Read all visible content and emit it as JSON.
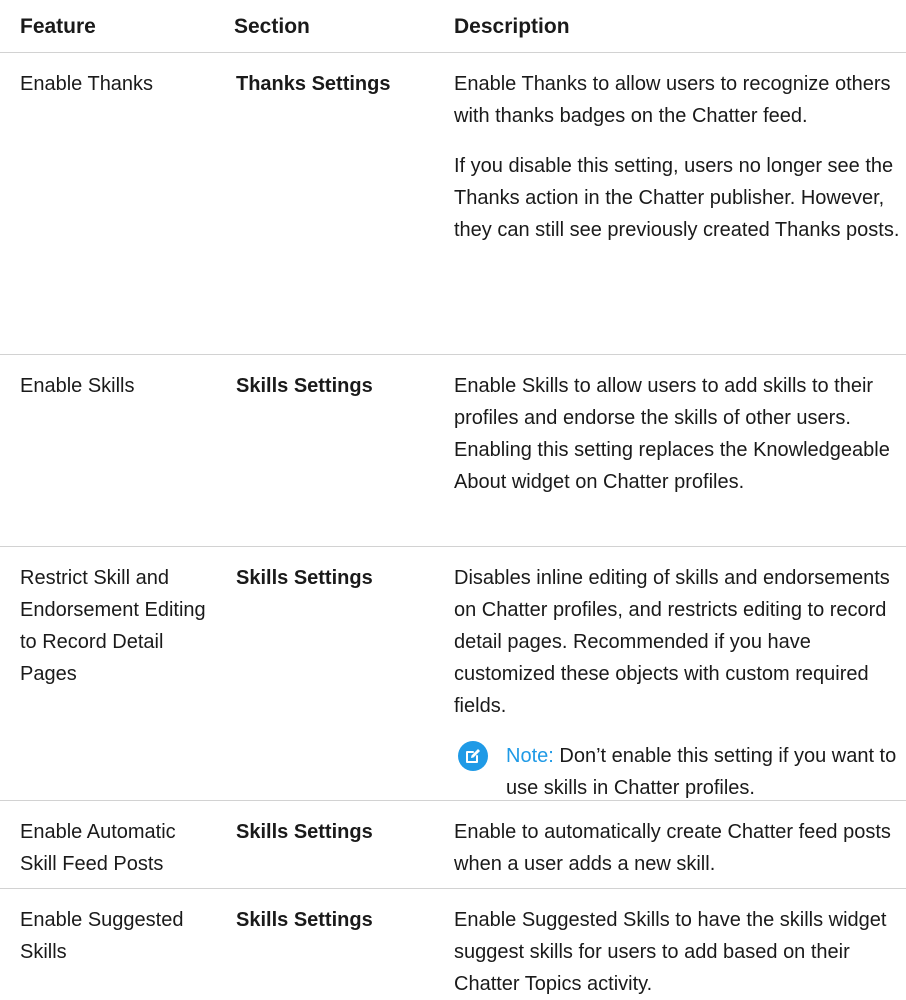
{
  "table": {
    "headers": {
      "feature": "Feature",
      "section": "Section",
      "description": "Description"
    },
    "rows": [
      {
        "feature": "Enable Thanks",
        "section": "Thanks Settings",
        "description": [
          "Enable Thanks to allow users to recognize others with thanks badges on the Chatter feed.",
          "If you disable this setting, users no longer see the Thanks action in the Chatter publisher. However, they can still see previously created Thanks posts."
        ]
      },
      {
        "feature": "Enable Skills",
        "section": "Skills Settings",
        "description": [
          "Enable Skills to allow users to add skills to their profiles and endorse the skills of other users. Enabling this setting replaces the Knowledgeable About widget on Chatter profiles."
        ]
      },
      {
        "feature": "Restrict Skill and Endorsement Editing to Record Detail Pages",
        "section": "Skills Settings",
        "description": [
          "Disables inline editing of skills and endorsements on Chatter profiles, and restricts editing to record detail pages. Recommended if you have customized these objects with custom required fields."
        ],
        "note": {
          "icon": "note-edit-icon",
          "label": "Note:",
          "text": "Don’t enable this setting if you want to use skills in Chatter profiles.",
          "color": "#1f9ae6"
        }
      },
      {
        "feature": "Enable Automatic Skill Feed Posts",
        "section": "Skills Settings",
        "description": [
          "Enable to automatically create Chatter feed posts when a user adds a new skill."
        ]
      },
      {
        "feature": "Enable Suggested Skills",
        "section": "Skills Settings",
        "description": [
          "Enable Suggested Skills to have the skills widget suggest skills for users to add based on their Chatter Topics activity."
        ]
      }
    ]
  }
}
